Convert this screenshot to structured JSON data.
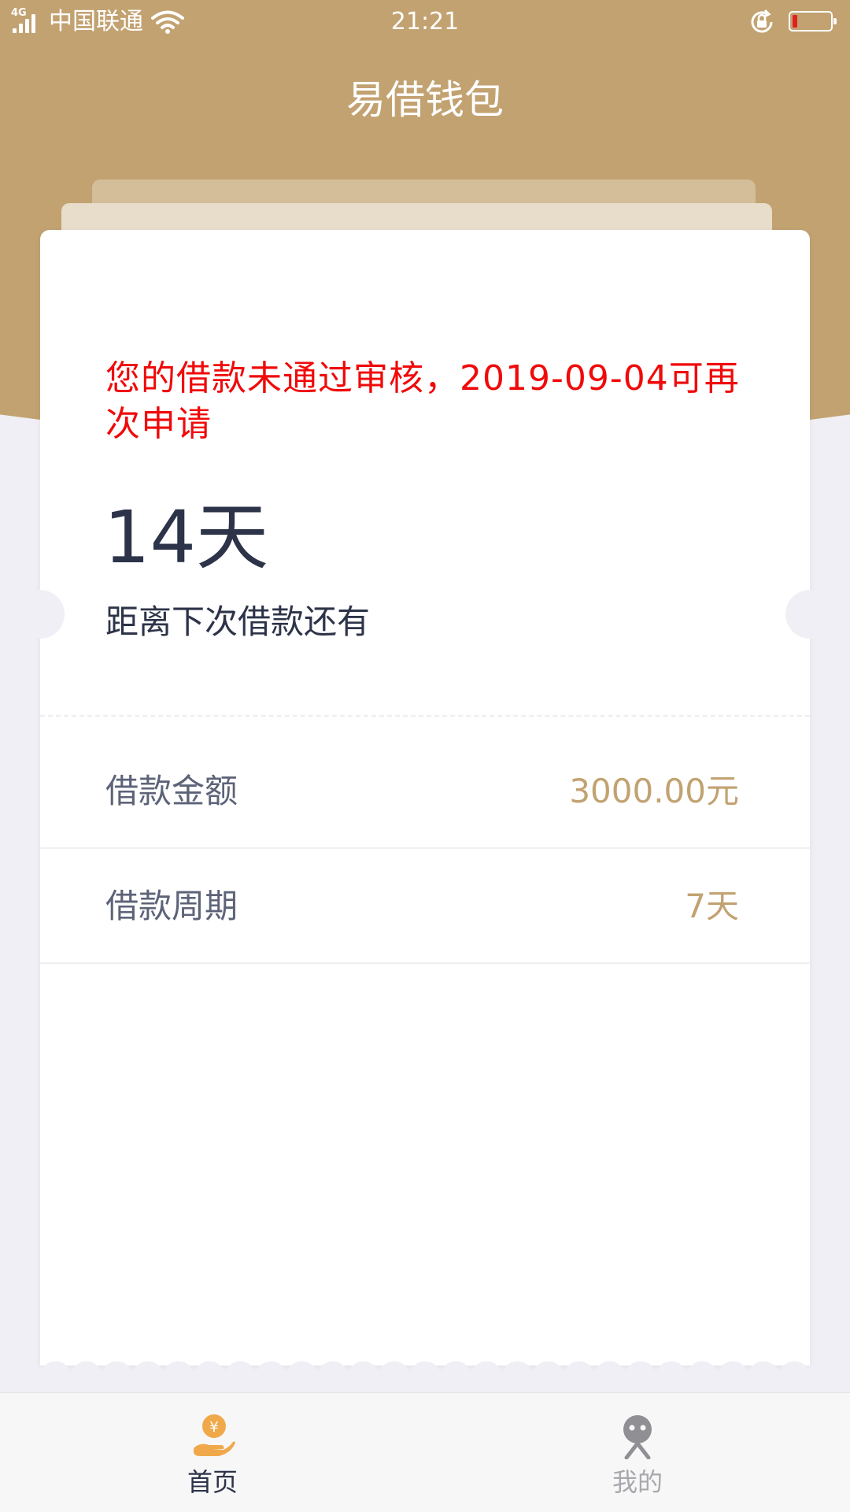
{
  "status_bar": {
    "network": "4G",
    "carrier": "中国联通",
    "time": "21:21",
    "battery_level": 0.12
  },
  "header": {
    "title": "易借钱包"
  },
  "card": {
    "rejection_message": "您的借款未通过审核，2019-09-04可再次申请",
    "days_remaining": "14天",
    "days_caption": "距离下次借款还有",
    "rows": [
      {
        "label": "借款金额",
        "value": "3000.00元"
      },
      {
        "label": "借款周期",
        "value": "7天"
      }
    ]
  },
  "tab_bar": {
    "tabs": [
      {
        "label": "首页",
        "icon": "hand-yuan-icon",
        "active": true
      },
      {
        "label": "我的",
        "icon": "user-profile-icon",
        "active": false
      }
    ]
  },
  "colors": {
    "brand": "#c2a271",
    "alert": "#f00a0a",
    "text_dark": "#2d3348",
    "background": "#f0eff5"
  }
}
